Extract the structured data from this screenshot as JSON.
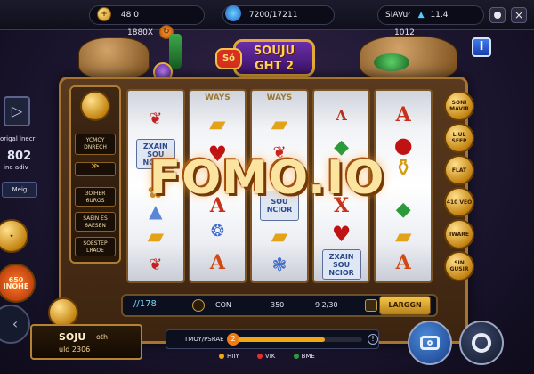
{
  "topbar": {
    "balance": "48 0",
    "multiplier": "1880X",
    "progress": "7200/17211",
    "player": "SIAVuł",
    "stat_a": "11.4",
    "stat_b": "1012"
  },
  "logo": {
    "badge": "Sŏ",
    "line1": "SOUJU",
    "line2": "GHT 2"
  },
  "headline": "FOMO.IO",
  "info_button": "I",
  "left_panel": {
    "top_label": "origal lnecr",
    "value": "802",
    "sub_label": "ine adiv",
    "button": "Meig",
    "items": [
      "YCMOY DNRECH",
      "1",
      "3OIHER 6UROS",
      "SAEIN ES 6AESEN",
      "SOESTEP LRAOE"
    ]
  },
  "reels": {
    "headers": [
      "",
      "WAYS",
      "WAYS",
      "",
      ""
    ],
    "card_texts": [
      "ZXAIN SOU NCIOR",
      "SOU NCIOR",
      "ZXAIN SOU NCIOR"
    ]
  },
  "right_medals": [
    "SONI MAVIR",
    "LIUL SEEP",
    "FLAT",
    "410 VEO",
    "IWARE",
    "SIN GUSIR"
  ],
  "left_medal": "650 INOHE",
  "control_bar": {
    "lines": "//178",
    "con_label": "CON",
    "bet": "350",
    "page": "9 2/30",
    "largen": "LARGGN"
  },
  "bottom_bar": {
    "label": "TMOY/PSRAE",
    "level": "2",
    "progress_fraction": 0.7
  },
  "legend": [
    "HIIY",
    "VIK",
    "BME"
  ],
  "promo": {
    "title": "SOJU",
    "suffix": "oth",
    "sub": "uld 2306"
  },
  "colors": {
    "accent_gold": "#f0a818",
    "panel_dark": "#0c0f1e",
    "frame_brown": "#a7742e"
  }
}
